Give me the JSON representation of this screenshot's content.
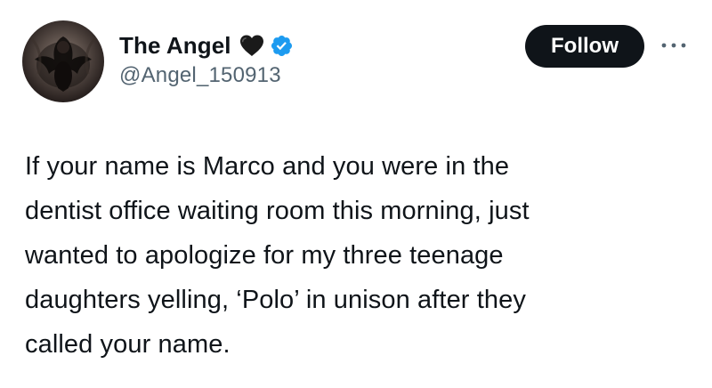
{
  "author": {
    "display_name": "The Angel",
    "handle": "@Angel_150913",
    "name_emoji": "black-heart-icon",
    "verified_badge": "verified-icon",
    "avatar": "avatar"
  },
  "actions": {
    "follow_label": "Follow",
    "more_icon": "more-horizontal-icon"
  },
  "tweet": {
    "lines": [
      "If your name is Marco and you were in the",
      "dentist office waiting room this morning, just",
      "wanted to apologize for my three teenage",
      "daughters yelling, ‘Polo’ in unison after they",
      "called your name."
    ]
  },
  "colors": {
    "text": "#0f1419",
    "secondary": "#536471",
    "follow_bg": "#0f1419",
    "verified": "#1d9bf0"
  }
}
